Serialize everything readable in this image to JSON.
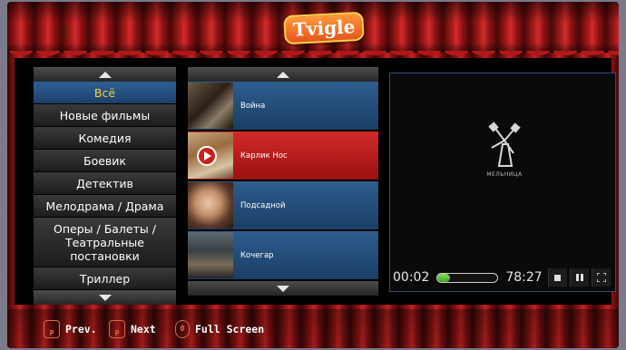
{
  "app": {
    "logo_text": "Tvigle"
  },
  "categories": {
    "items": [
      {
        "label": "Всё",
        "active": true
      },
      {
        "label": "Новые фильмы"
      },
      {
        "label": "Комедия"
      },
      {
        "label": "Боевик"
      },
      {
        "label": "Детектив"
      },
      {
        "label": "Мелодрама / Драма"
      },
      {
        "label": "Оперы / Балеты / Театральные постановки"
      },
      {
        "label": "Триллер"
      }
    ]
  },
  "films": {
    "items": [
      {
        "title": "Война"
      },
      {
        "title": "Карлик Нос",
        "active": true
      },
      {
        "title": "Подсадной"
      },
      {
        "title": "Кочегар"
      }
    ]
  },
  "player": {
    "studio_caption": "МЕЛЬНИЦА",
    "elapsed": "00:02",
    "duration": "78:27",
    "progress_fraction": 0.2
  },
  "footer": {
    "prev_key": "P",
    "prev_label": "Prev.",
    "next_key": "P",
    "next_label": "Next",
    "fullscreen_key": "0",
    "fullscreen_label": "Full Screen"
  },
  "colors": {
    "accent_active_category": "#f2d23a",
    "selected_film": "#d42a2a",
    "list_blue": "#2e5d8f"
  }
}
